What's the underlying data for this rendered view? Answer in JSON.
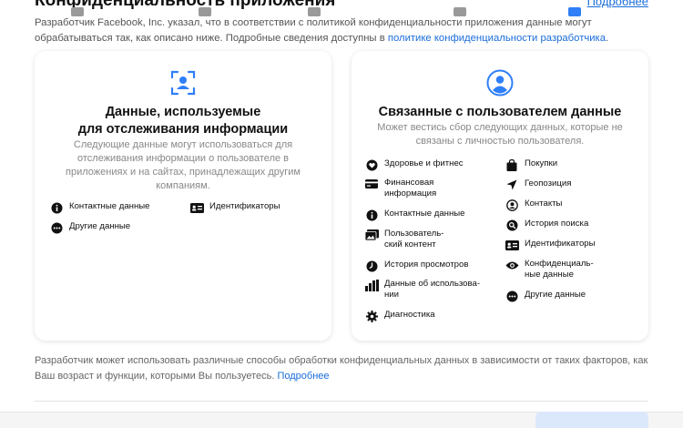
{
  "header": {
    "title": "Конфиденциальность приложения",
    "more_link": "Подробнее"
  },
  "intro": {
    "prefix": "Разработчик ",
    "developer": "Facebook, Inc.",
    "text": " указал, что в соответствии с политикой конфиденциальности приложения данные могут обрабатываться так, как описано ниже. Подробные сведения доступны в ",
    "link": "политике конфиденциальности разработчика",
    "suffix": "."
  },
  "tracking_card": {
    "icon": "tracking-icon",
    "title_line1": "Данные, используемые",
    "title_line2": "для отслеживания информации",
    "description": "Следующие данные могут использоваться для отслеживания информации о пользователе в приложениях и на сайтах, принадлежащих другим компаниям.",
    "items": [
      {
        "icon": "info-icon",
        "label": "Контактные данные"
      },
      {
        "icon": "id-card-icon",
        "label": "Идентификаторы"
      },
      {
        "icon": "more-icon",
        "label": "Другие данные"
      }
    ]
  },
  "linked_card": {
    "icon": "person-icon",
    "title": "Связанные с пользователем данные",
    "description": "Может вестись сбор следующих данных, которые не связаны с личностью пользователя.",
    "left_items": [
      {
        "icon": "heart-icon",
        "label": "Здоровье и фитнес"
      },
      {
        "icon": "credit-card-icon",
        "label": "Финансовая\nинформация"
      },
      {
        "icon": "info-icon",
        "label": "Контактные данные"
      },
      {
        "icon": "photo-icon",
        "label": "Пользователь-\nский контент"
      },
      {
        "icon": "clock-icon",
        "label": "История просмотров"
      },
      {
        "icon": "bar-chart-icon",
        "label": "Данные об использова-\nнии"
      },
      {
        "icon": "gear-icon",
        "label": "Диагностика"
      }
    ],
    "right_items": [
      {
        "icon": "bag-icon",
        "label": "Покупки"
      },
      {
        "icon": "location-icon",
        "label": "Геопозиция"
      },
      {
        "icon": "contact-icon",
        "label": "Контакты"
      },
      {
        "icon": "search-icon",
        "label": "История поиска"
      },
      {
        "icon": "id-card-icon",
        "label": "Идентификаторы"
      },
      {
        "icon": "eye-icon",
        "label": "Конфиденциаль-\nные данные"
      },
      {
        "icon": "more-icon",
        "label": "Другие данные"
      }
    ]
  },
  "footer": {
    "text": "Разработчик может использовать различные способы обработки конфиденциальных данных в зависимости от таких факторов, как Ваш возраст и функции, которыми Вы пользуетесь. ",
    "link": "Подробнее"
  },
  "colors": {
    "accent": "#1a6dd9",
    "icon_blue": "#2f7ef7"
  }
}
